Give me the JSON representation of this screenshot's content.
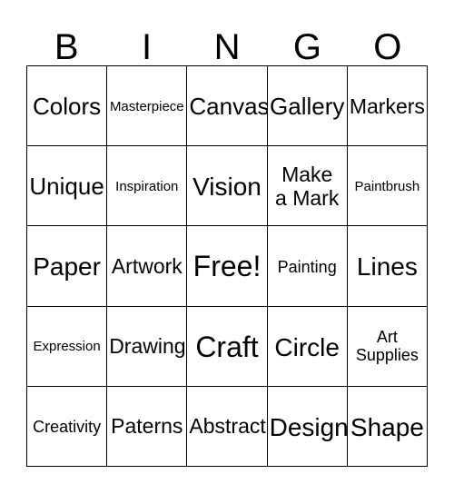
{
  "card": {
    "title": "BINGO",
    "header_letters": [
      "B",
      "I",
      "N",
      "G",
      "O"
    ],
    "border_color": "#000000",
    "background_color": "#ffffff",
    "text_color": "#000000",
    "rows": [
      [
        {
          "label": "Colors",
          "size": "fs-lg"
        },
        {
          "label": "Masterpiece",
          "size": "fs-xs"
        },
        {
          "label": "Canvas",
          "size": "fs-lg"
        },
        {
          "label": "Gallery",
          "size": "fs-lg"
        },
        {
          "label": "Markers",
          "size": "fs-md"
        }
      ],
      [
        {
          "label": "Unique",
          "size": "fs-lg"
        },
        {
          "label": "Inspiration",
          "size": "fs-xs"
        },
        {
          "label": "Vision",
          "size": "fs-xl"
        },
        {
          "label": "Make\na Mark",
          "size": "fs-md"
        },
        {
          "label": "Paintbrush",
          "size": "fs-xs"
        }
      ],
      [
        {
          "label": "Paper",
          "size": "fs-xl"
        },
        {
          "label": "Artwork",
          "size": "fs-md"
        },
        {
          "label": "Free!",
          "size": "fs-xxl"
        },
        {
          "label": "Painting",
          "size": "fs-sm"
        },
        {
          "label": "Lines",
          "size": "fs-xl"
        }
      ],
      [
        {
          "label": "Expression",
          "size": "fs-xs"
        },
        {
          "label": "Drawing",
          "size": "fs-md"
        },
        {
          "label": "Craft",
          "size": "fs-xxl"
        },
        {
          "label": "Circle",
          "size": "fs-xl"
        },
        {
          "label": "Art\nSupplies",
          "size": "fs-sm"
        }
      ],
      [
        {
          "label": "Creativity",
          "size": "fs-sm"
        },
        {
          "label": "Paterns",
          "size": "fs-md"
        },
        {
          "label": "Abstract",
          "size": "fs-md"
        },
        {
          "label": "Design",
          "size": "fs-xl"
        },
        {
          "label": "Shape",
          "size": "fs-xl"
        }
      ]
    ]
  }
}
